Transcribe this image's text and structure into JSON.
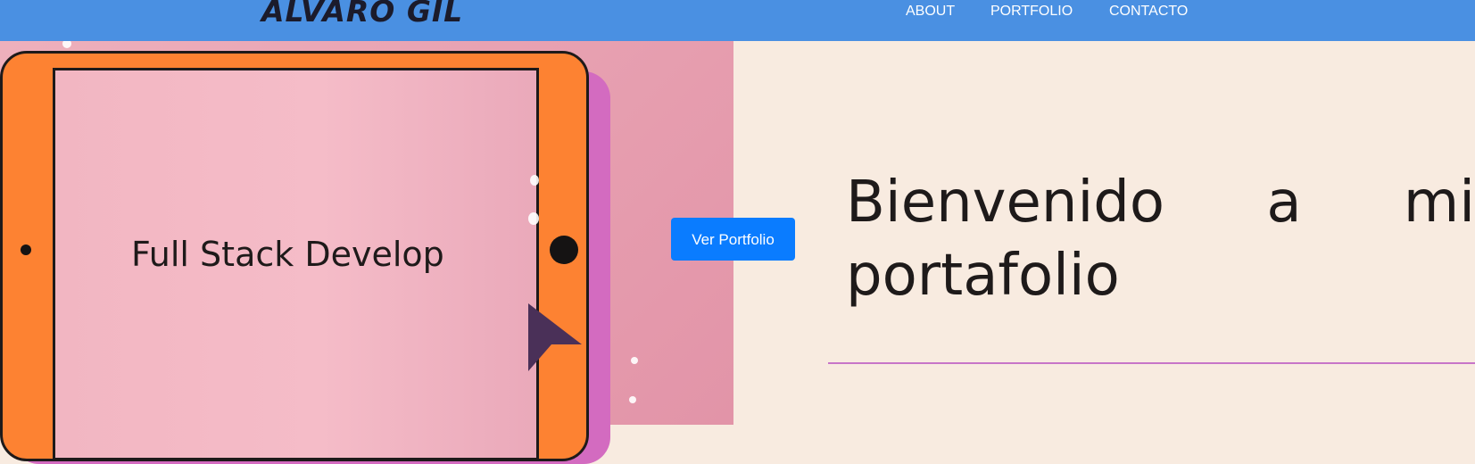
{
  "navbar": {
    "brand": "ALVARO GIL",
    "links": [
      {
        "label": "ABOUT"
      },
      {
        "label": "PORTFOLIO"
      },
      {
        "label": "CONTACTO"
      }
    ],
    "background_color": "#4a90e2"
  },
  "hero": {
    "screen_text": "Full Stack Develop",
    "cta_label": "Ver Portfolio",
    "title_words": [
      "Bienvenido",
      "a",
      "mi"
    ],
    "title_line2": "portafolio",
    "cta_color": "#0a7cff",
    "tablet_color": "#fd8232",
    "accent_color": "#c775c8",
    "icons": {
      "cursor": "cursor-arrow-icon"
    }
  }
}
